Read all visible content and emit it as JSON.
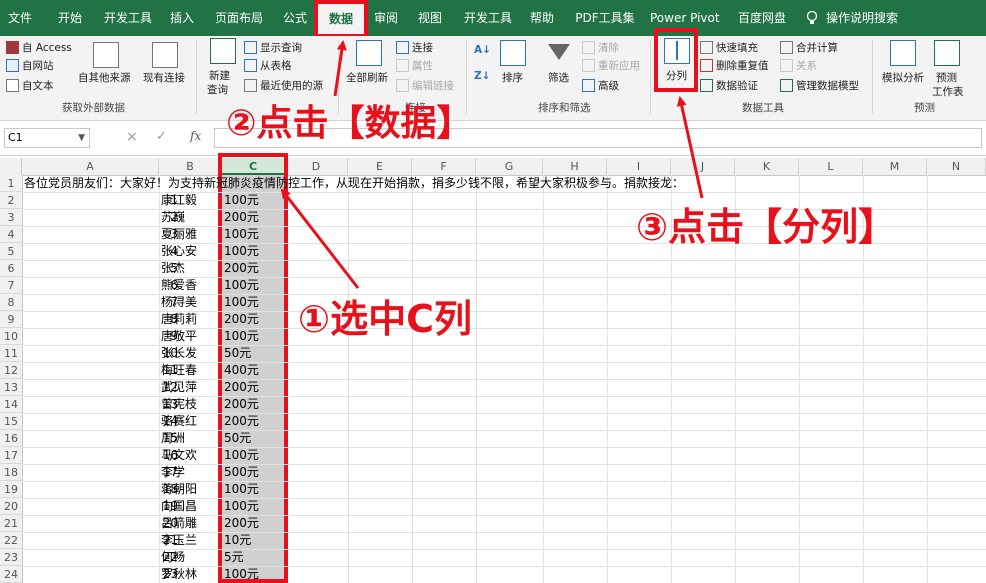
{
  "tabs": [
    "文件",
    "开始",
    "开发工具",
    "插入",
    "页面布局",
    "公式",
    "数据",
    "审阅",
    "视图",
    "开发工具",
    "帮助",
    "PDF工具集",
    "Power Pivot",
    "百度网盘",
    "操作说明搜索"
  ],
  "active_tab": "数据",
  "ribbon": {
    "get_external": {
      "access": "自 Access",
      "web": "自网站",
      "text": "自文本",
      "other_sources": "自其他来源",
      "existing": "现有连接",
      "group": "获取外部数据"
    },
    "query": {
      "new_query_1": "新建",
      "new_query_2": "查询",
      "show_queries": "显示查询",
      "from_table": "从表格",
      "recent_sources": "最近使用的源",
      "group": "获取和转换"
    },
    "connections": {
      "refresh_all": "全部刷新",
      "connections": "连接",
      "properties": "属性",
      "edit_links": "编辑链接",
      "group": "连接"
    },
    "sort_filter": {
      "sort": "排序",
      "filter": "筛选",
      "clear": "清除",
      "reapply": "重新应用",
      "advanced": "高级",
      "group": "排序和筛选"
    },
    "data_tools": {
      "text_to_columns": "分列",
      "flash_fill": "快速填充",
      "remove_dup": "删除重复值",
      "validation": "数据验证",
      "consolidate": "合并计算",
      "relationships": "关系",
      "data_model": "管理数据模型",
      "group": "数据工具"
    },
    "forecast": {
      "whatif": "模拟分析",
      "sheet_1": "预测",
      "sheet_2": "工作表",
      "group": "预测"
    }
  },
  "formula_bar": {
    "name_box": "C1",
    "cancel": "×",
    "confirm": "✓",
    "fx": "fx",
    "value": ""
  },
  "columns": [
    "A",
    "B",
    "C",
    "D",
    "E",
    "F",
    "G",
    "H",
    "I",
    "J",
    "K",
    "L",
    "M",
    "N"
  ],
  "selected_column": "C",
  "row1_text": "各位党员朋友们：大家好！为支持新冠肺炎疫情防控工作，从现在开始捐款，捐多少钱不限，希望大家积极参与。捐款接龙：",
  "rows": [
    {
      "n": "2",
      "a": "1",
      "b": "康江毅",
      "c": "100元"
    },
    {
      "n": "3",
      "a": "2",
      "b": "苏巍",
      "c": "200元"
    },
    {
      "n": "4",
      "a": "3",
      "b": "夏丽雅",
      "c": "100元"
    },
    {
      "n": "5",
      "a": "4",
      "b": "张心安",
      "c": "100元"
    },
    {
      "n": "6",
      "a": "5",
      "b": "张杰",
      "c": "200元"
    },
    {
      "n": "7",
      "a": "6",
      "b": "熊爱香",
      "c": "100元"
    },
    {
      "n": "8",
      "a": "7",
      "b": "杨浔美",
      "c": "100元"
    },
    {
      "n": "9",
      "a": "8",
      "b": "唐莉莉",
      "c": "200元"
    },
    {
      "n": "10",
      "a": "9",
      "b": "唐敬平",
      "c": "100元"
    },
    {
      "n": "11",
      "a": "10",
      "b": "张长发",
      "c": "50元"
    },
    {
      "n": "12",
      "a": "11",
      "b": "梅旺春",
      "c": "400元"
    },
    {
      "n": "13",
      "a": "12",
      "b": "武见萍",
      "c": "200元"
    },
    {
      "n": "14",
      "a": "13",
      "b": "曾宪枝",
      "c": "200元"
    },
    {
      "n": "15",
      "a": "14",
      "b": "骆赛红",
      "c": "200元"
    },
    {
      "n": "16",
      "a": "15",
      "b": "周洲",
      "c": "50元"
    },
    {
      "n": "17",
      "a": "16",
      "b": "马文欢",
      "c": "100元"
    },
    {
      "n": "18",
      "a": "17",
      "b": "李学",
      "c": "500元"
    },
    {
      "n": "19",
      "a": "18",
      "b": "蒋朝阳",
      "c": "100元"
    },
    {
      "n": "20",
      "a": "19",
      "b": "向国昌",
      "c": "100元"
    },
    {
      "n": "21",
      "a": "20",
      "b": "吕箭雕",
      "c": "200元"
    },
    {
      "n": "22",
      "a": "21",
      "b": "李玉兰",
      "c": "10元"
    },
    {
      "n": "23",
      "a": "22",
      "b": "何畅",
      "c": "5元"
    },
    {
      "n": "24",
      "a": "23",
      "b": "罗秋林",
      "c": "100元"
    }
  ],
  "annotations": {
    "step1": "①选中C列",
    "step2": "②点击【数据】",
    "step3": "③点击【分列】"
  },
  "colors": {
    "accent": "#217346",
    "annotation": "#e8101a",
    "selection": "#d0d0d0"
  }
}
